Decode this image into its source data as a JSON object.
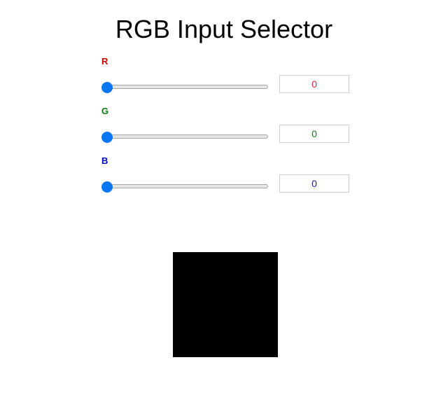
{
  "title": "RGB Input Selector",
  "channels": [
    {
      "label": "R",
      "value": "0",
      "fraction": 0,
      "color": "#cc0000",
      "value_color": "#e0283c"
    },
    {
      "label": "G",
      "value": "0",
      "fraction": 0,
      "color": "#0a7a0a",
      "value_color": "#1f7a1f"
    },
    {
      "label": "B",
      "value": "0",
      "fraction": 0,
      "color": "#0000cc",
      "value_color": "#23239a"
    }
  ],
  "preview": {
    "color": "#000000"
  },
  "accent": "#0a76f4"
}
